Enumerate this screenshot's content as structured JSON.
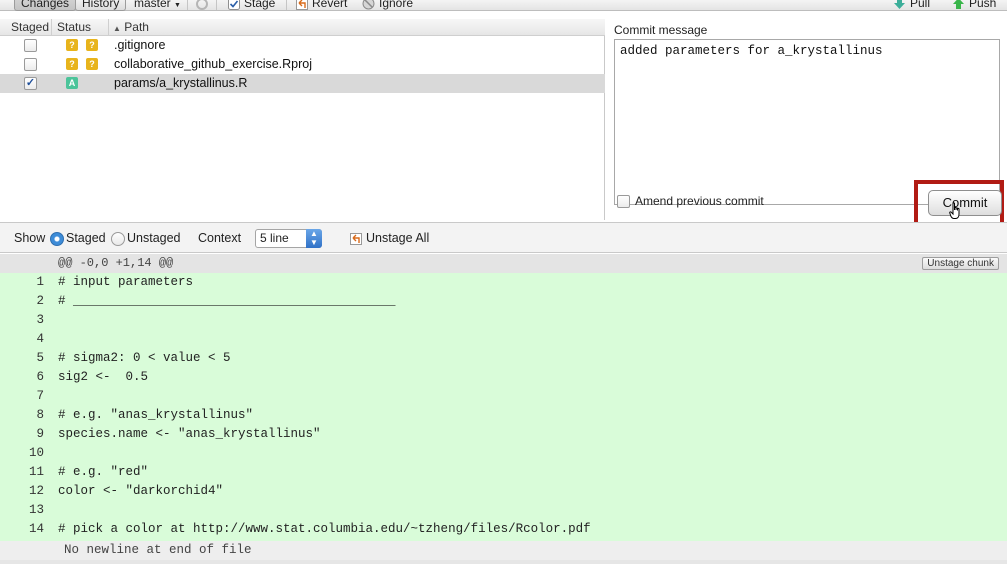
{
  "toolbar": {
    "changes_label": "Changes",
    "history_label": "History",
    "branch": "master",
    "stage_label": "Stage",
    "revert_label": "Revert",
    "ignore_label": "Ignore",
    "pull_label": "Pull",
    "push_label": "Push"
  },
  "file_list": {
    "headers": {
      "staged": "Staged",
      "status": "Status",
      "path": "Path"
    },
    "files": [
      {
        "path": ".gitignore",
        "staged": false,
        "status": [
          "?",
          "?"
        ]
      },
      {
        "path": "collaborative_github_exercise.Rproj",
        "staged": false,
        "status": [
          "?",
          "?"
        ]
      },
      {
        "path": "params/a_krystallinus.R",
        "staged": true,
        "status": [
          "A"
        ]
      }
    ]
  },
  "commit": {
    "label": "Commit message",
    "message": "added parameters for a_krystallinus",
    "amend_label": "Amend previous commit",
    "commit_button": "Commit"
  },
  "diff_controls": {
    "show_label": "Show",
    "staged_label": "Staged",
    "unstaged_label": "Unstaged",
    "context_label": "Context",
    "context_value": "5 line",
    "unstage_all_label": "Unstage All"
  },
  "diff": {
    "hunk_header": "@@ -0,0 +1,14 @@",
    "unstage_chunk_label": "Unstage chunk",
    "lines": [
      {
        "num": "1",
        "text": "# input parameters"
      },
      {
        "num": "2",
        "text": "# ___________________________________________"
      },
      {
        "num": "3",
        "text": ""
      },
      {
        "num": "4",
        "text": ""
      },
      {
        "num": "5",
        "text": "# sigma2: 0 < value < 5"
      },
      {
        "num": "6",
        "text": "sig2 <-  0.5"
      },
      {
        "num": "7",
        "text": ""
      },
      {
        "num": "8",
        "text": "# e.g. \"anas_krystallinus\""
      },
      {
        "num": "9",
        "text": "species.name <- \"anas_krystallinus\""
      },
      {
        "num": "10",
        "text": ""
      },
      {
        "num": "11",
        "text": "# e.g. \"red\""
      },
      {
        "num": "12",
        "text": "color <- \"darkorchid4\""
      },
      {
        "num": "13",
        "text": ""
      },
      {
        "num": "14",
        "text": "# pick a color at http://www.stat.columbia.edu/~tzheng/files/Rcolor.pdf"
      }
    ],
    "no_newline_text": "No newline at end of file"
  },
  "colors": {
    "added_line_bg": "#d9fcd9",
    "highlight_border": "#b11b14",
    "selected_row_bg": "#d9d9d9"
  }
}
